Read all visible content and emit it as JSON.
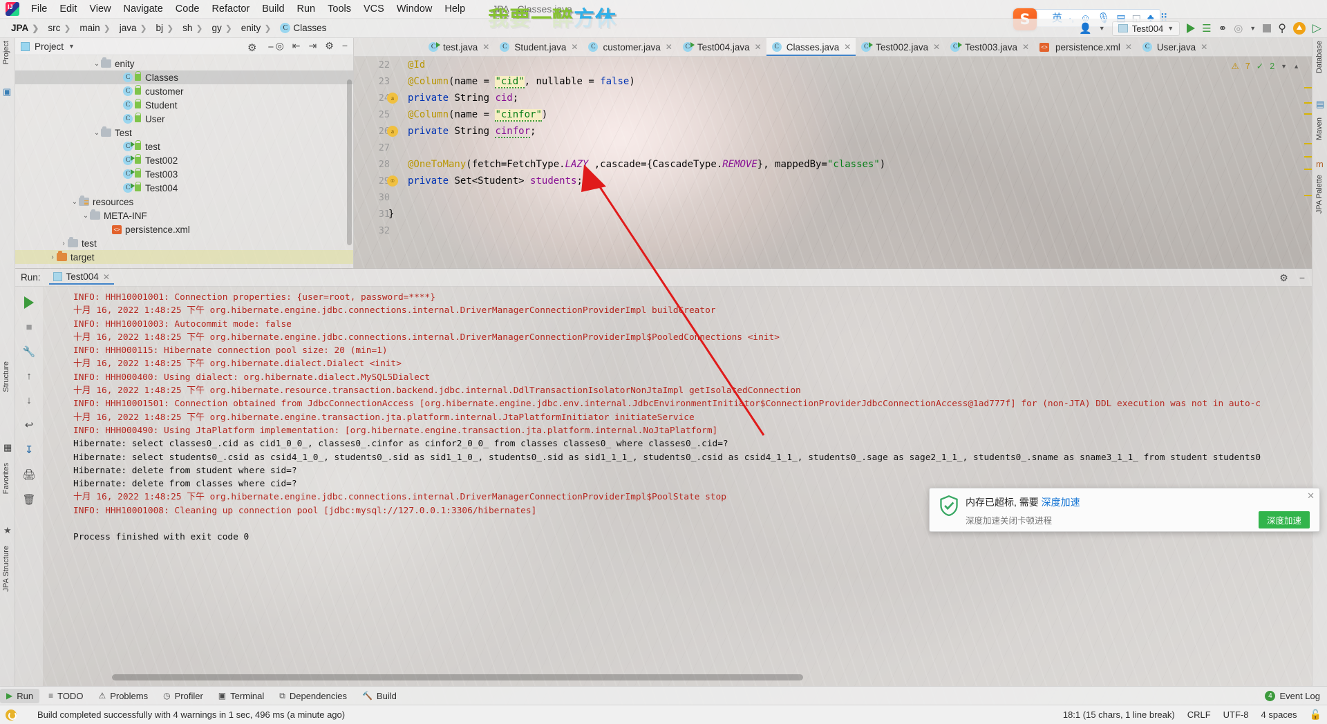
{
  "window": {
    "title": "JPA - Classes.java"
  },
  "watermark": {
    "green": "我要一醉",
    "blue": "方休"
  },
  "menu": {
    "items": [
      "File",
      "Edit",
      "View",
      "Navigate",
      "Code",
      "Refactor",
      "Build",
      "Run",
      "Tools",
      "VCS",
      "Window",
      "Help"
    ]
  },
  "ime": {
    "name": "sogou-ime",
    "mode": "英",
    "icons": [
      "punctuation-icon",
      "emoji-icon",
      "microphone-icon",
      "keyboard-icon",
      "screenshot-icon",
      "skin-icon",
      "apps-icon"
    ]
  },
  "breadcrumb": {
    "items": [
      "JPA",
      "src",
      "main",
      "java",
      "bj",
      "sh",
      "gy",
      "enity",
      "Classes"
    ]
  },
  "toolbar_right": {
    "run_config": "Test004",
    "buttons": [
      "run-button",
      "build-button",
      "debug-button",
      "run-coverage-button",
      "stop-button",
      "search-everywhere-button",
      "update-project-button",
      "ide-assistant-button"
    ]
  },
  "left_strip": {
    "items": [
      "Project",
      "Structure",
      "Favorites",
      "JPA Structure"
    ]
  },
  "right_strip": {
    "items": [
      "Database",
      "Maven",
      "JPA Palette"
    ]
  },
  "project": {
    "title": "Project",
    "actions": [
      "locate-icon",
      "collapse-all-icon",
      "expand-all-icon",
      "settings-icon",
      "hide-icon"
    ],
    "tree": [
      {
        "label": "enity",
        "indent": 7,
        "type": "folder",
        "arrow": "v",
        "state": ""
      },
      {
        "label": "Classes",
        "indent": 9,
        "type": "class",
        "arrow": "",
        "state": "sel"
      },
      {
        "label": "customer",
        "indent": 9,
        "type": "class",
        "arrow": "",
        "state": ""
      },
      {
        "label": "Student",
        "indent": 9,
        "type": "class",
        "arrow": "",
        "state": ""
      },
      {
        "label": "User",
        "indent": 9,
        "type": "class",
        "arrow": "",
        "state": ""
      },
      {
        "label": "Test",
        "indent": 7,
        "type": "folder",
        "arrow": "v",
        "state": ""
      },
      {
        "label": "test",
        "indent": 9,
        "type": "runclass",
        "arrow": "",
        "state": ""
      },
      {
        "label": "Test002",
        "indent": 9,
        "type": "runclass",
        "arrow": "",
        "state": ""
      },
      {
        "label": "Test003",
        "indent": 9,
        "type": "runclass",
        "arrow": "",
        "state": ""
      },
      {
        "label": "Test004",
        "indent": 9,
        "type": "runclass",
        "arrow": "",
        "state": ""
      },
      {
        "label": "resources",
        "indent": 5,
        "type": "resfolder",
        "arrow": "v",
        "state": ""
      },
      {
        "label": "META-INF",
        "indent": 6,
        "type": "folder",
        "arrow": "v",
        "state": ""
      },
      {
        "label": "persistence.xml",
        "indent": 8,
        "type": "xml",
        "arrow": "",
        "state": ""
      },
      {
        "label": "test",
        "indent": 4,
        "type": "folder",
        "arrow": ">",
        "state": ""
      },
      {
        "label": "target",
        "indent": 3,
        "type": "ofolder",
        "arrow": ">",
        "state": "hl"
      }
    ]
  },
  "editor_tabs": [
    {
      "label": "test.java",
      "icon": "runclass",
      "active": false
    },
    {
      "label": "Student.java",
      "icon": "class",
      "active": false
    },
    {
      "label": "customer.java",
      "icon": "class",
      "active": false
    },
    {
      "label": "Test004.java",
      "icon": "runclass",
      "active": false
    },
    {
      "label": "Classes.java",
      "icon": "class",
      "active": true
    },
    {
      "label": "Test002.java",
      "icon": "runclass",
      "active": false
    },
    {
      "label": "Test003.java",
      "icon": "runclass",
      "active": false
    },
    {
      "label": "persistence.xml",
      "icon": "xml",
      "active": false
    },
    {
      "label": "User.java",
      "icon": "class",
      "active": false
    }
  ],
  "inspections": {
    "warnings": "7",
    "ok": "2"
  },
  "code": {
    "first_line": 22,
    "lines": [
      {
        "n": 22,
        "gutter": "",
        "text": "@Id"
      },
      {
        "n": 23,
        "gutter": "",
        "text": "@Column(name = \"cid\", nullable = false)"
      },
      {
        "n": 24,
        "gutter": "a",
        "text": "private String cid;"
      },
      {
        "n": 25,
        "gutter": "",
        "text": "@Column(name = \"cinfor\")"
      },
      {
        "n": 26,
        "gutter": "a",
        "text": "private String cinfor;"
      },
      {
        "n": 27,
        "gutter": "",
        "text": ""
      },
      {
        "n": 28,
        "gutter": "",
        "text": "@OneToMany(fetch=FetchType.LAZY ,cascade={CascadeType.REMOVE}, mappedBy=\"classes\")"
      },
      {
        "n": 29,
        "gutter": "o",
        "text": "private Set<Student> students;"
      },
      {
        "n": 30,
        "gutter": "",
        "text": ""
      },
      {
        "n": 31,
        "gutter": "",
        "text": "}"
      },
      {
        "n": 32,
        "gutter": "",
        "text": ""
      }
    ]
  },
  "run_window": {
    "label": "Run:",
    "tab": "Test004",
    "actions": [
      "settings-icon",
      "hide-icon"
    ],
    "side_buttons": [
      "rerun-button",
      "stop-button",
      "wrench-button",
      "up-button",
      "down-button",
      "soft-wrap-button",
      "scroll-to-end-button",
      "print-button",
      "clear-all-button"
    ],
    "console": [
      {
        "c": "red",
        "t": "INFO: HHH10001001: Connection properties: {user=root, password=****}"
      },
      {
        "c": "red",
        "t": "十月 16, 2022 1:48:25 下午 org.hibernate.engine.jdbc.connections.internal.DriverManagerConnectionProviderImpl buildCreator"
      },
      {
        "c": "red",
        "t": "INFO: HHH10001003: Autocommit mode: false"
      },
      {
        "c": "red",
        "t": "十月 16, 2022 1:48:25 下午 org.hibernate.engine.jdbc.connections.internal.DriverManagerConnectionProviderImpl$PooledConnections <init>"
      },
      {
        "c": "red",
        "t": "INFO: HHH000115: Hibernate connection pool size: 20 (min=1)"
      },
      {
        "c": "red",
        "t": "十月 16, 2022 1:48:25 下午 org.hibernate.dialect.Dialect <init>"
      },
      {
        "c": "red",
        "t": "INFO: HHH000400: Using dialect: org.hibernate.dialect.MySQL5Dialect"
      },
      {
        "c": "red",
        "t": "十月 16, 2022 1:48:25 下午 org.hibernate.resource.transaction.backend.jdbc.internal.DdlTransactionIsolatorNonJtaImpl getIsolatedConnection"
      },
      {
        "c": "red",
        "t": "INFO: HHH10001501: Connection obtained from JdbcConnectionAccess [org.hibernate.engine.jdbc.env.internal.JdbcEnvironmentInitiator$ConnectionProviderJdbcConnectionAccess@1ad777f] for (non-JTA) DDL execution was not in auto-c"
      },
      {
        "c": "red",
        "t": "十月 16, 2022 1:48:25 下午 org.hibernate.engine.transaction.jta.platform.internal.JtaPlatformInitiator initiateService"
      },
      {
        "c": "red",
        "t": "INFO: HHH000490: Using JtaPlatform implementation: [org.hibernate.engine.transaction.jta.platform.internal.NoJtaPlatform]"
      },
      {
        "c": "black",
        "t": "Hibernate: select classes0_.cid as cid1_0_0_, classes0_.cinfor as cinfor2_0_0_ from classes classes0_ where classes0_.cid=?"
      },
      {
        "c": "black",
        "t": "Hibernate: select students0_.csid as csid4_1_0_, students0_.sid as sid1_1_0_, students0_.sid as sid1_1_1_, students0_.csid as csid4_1_1_, students0_.sage as sage2_1_1_, students0_.sname as sname3_1_1_ from student students0"
      },
      {
        "c": "black",
        "t": "Hibernate: delete from student where sid=?"
      },
      {
        "c": "black",
        "t": "Hibernate: delete from classes where cid=?"
      },
      {
        "c": "red",
        "t": "十月 16, 2022 1:48:25 下午 org.hibernate.engine.jdbc.connections.internal.DriverManagerConnectionProviderImpl$PoolState stop"
      },
      {
        "c": "red",
        "t": "INFO: HHH10001008: Cleaning up connection pool [jdbc:mysql://127.0.0.1:3306/hibernates]"
      },
      {
        "c": "black",
        "t": ""
      },
      {
        "c": "black",
        "t": "Process finished with exit code 0"
      }
    ]
  },
  "bottom_bar": {
    "items": [
      {
        "label": "Run",
        "icon": "run-icon",
        "active": true
      },
      {
        "label": "TODO",
        "icon": "todo-icon",
        "active": false
      },
      {
        "label": "Problems",
        "icon": "problems-icon",
        "active": false
      },
      {
        "label": "Profiler",
        "icon": "profiler-icon",
        "active": false
      },
      {
        "label": "Terminal",
        "icon": "terminal-icon",
        "active": false
      },
      {
        "label": "Dependencies",
        "icon": "dependencies-icon",
        "active": false
      },
      {
        "label": "Build",
        "icon": "build-icon",
        "active": false
      }
    ],
    "event_log": "Event Log",
    "event_count": "4"
  },
  "status_bar": {
    "message": "Build completed successfully with 4 warnings in 1 sec, 496 ms (a minute ago)",
    "caret": "18:1 (15 chars, 1 line break)",
    "line_sep": "CRLF",
    "encoding": "UTF-8",
    "indent": "4 spaces"
  },
  "toast": {
    "title_prefix": "内存已超标, 需要 ",
    "title_link": "深度加速",
    "subtitle": "深度加速关闭卡顿进程",
    "button": "深度加速"
  },
  "colors": {
    "accent_blue": "#4083c9",
    "run_green": "#3c9a3c",
    "warn_yellow": "#d8b400",
    "console_red": "#b5271f",
    "annotation_red": "#e01b1b",
    "watermark_green": "#86c232",
    "watermark_blue": "#31b0e8"
  }
}
